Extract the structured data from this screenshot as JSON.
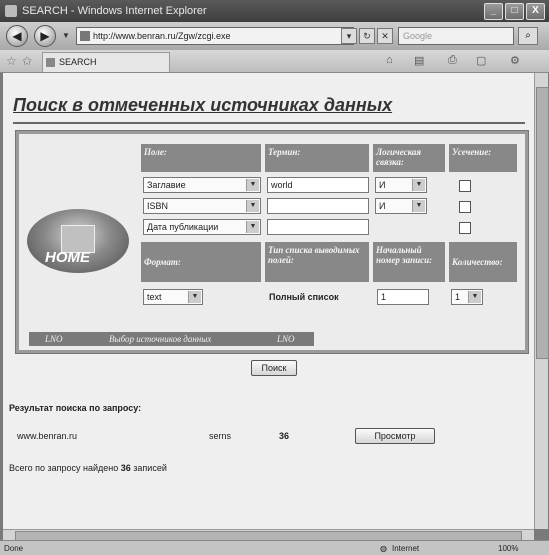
{
  "window": {
    "title": "SEARCH - Windows Internet Explorer",
    "ctrl_min": "_",
    "ctrl_max": "□",
    "ctrl_close": "X"
  },
  "toolbar": {
    "address": "http://www.benran.ru/Zgw/zcgi.exe",
    "search_placeholder": "Google",
    "back_icon": "◀",
    "forward_icon": "▶",
    "nav_dropdown": "▼",
    "refresh_icon": "↻",
    "stop_icon": "✕",
    "dropdown_icon": "▾",
    "search_icon": "⌕"
  },
  "tabs": {
    "active_label": "SEARCH",
    "star1": "☆",
    "star2": "✩",
    "home_icon": "⌂",
    "feeds_icon": "▤",
    "print_icon": "⎙",
    "page_icon": "▢",
    "tools_icon": "⚙"
  },
  "page": {
    "heading": "Поиск в отмеченных источниках данных",
    "logo_text": "HOME",
    "headers": {
      "field": "Поле:",
      "term": "Термин:",
      "logic": "Логическая связка:",
      "truncate": "Усечение:",
      "format": "Формат:",
      "list_type": "Тип списка выводимых полей:",
      "start_record": "Начальный номер записи:",
      "count": "Количество:"
    },
    "rows": [
      {
        "field": "Заглавие",
        "term": "world",
        "logic": "И"
      },
      {
        "field": "ISBN",
        "term": "",
        "logic": "И"
      },
      {
        "field": "Дата публикации",
        "term": "",
        "logic": ""
      }
    ],
    "format_value": "text",
    "list_type_value": "Полный список",
    "start_record_value": "1",
    "count_value": "1",
    "bar_left": "LNO",
    "bar_text": "Выбор источников данных",
    "bar_right": "LNO",
    "search_button": "Поиск",
    "result_title": "Результат поиска по запросу:",
    "result_source": "www.benran.ru",
    "result_db": "serns",
    "result_count": "36",
    "view_button": "Просмотр",
    "total_prefix": "Всего по запросу найдено",
    "total_count": "36",
    "total_suffix": "записей"
  },
  "status": {
    "left": "Done",
    "zone": "Internet",
    "zoom": "100%"
  },
  "colors": {
    "panel": "#9a9a9a",
    "header_cell": "#888888",
    "page_bg": "#efefef"
  }
}
